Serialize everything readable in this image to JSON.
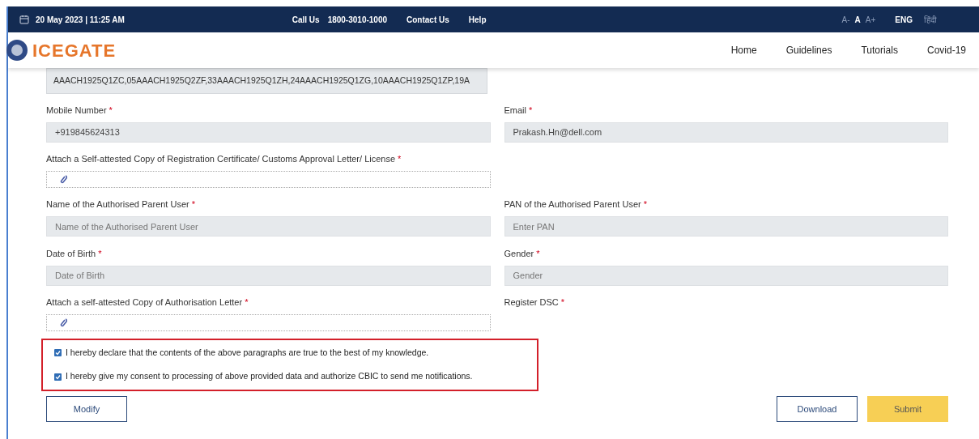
{
  "top_bar": {
    "datetime": "20 May 2023 | 11:25 AM",
    "links": [
      "Call Us",
      "1800-3010-1000",
      "Contact Us",
      "Help"
    ],
    "font_sizes": [
      {
        "label": "A-",
        "selected": false
      },
      {
        "label": "A",
        "selected": true
      },
      {
        "label": "A+",
        "selected": false
      }
    ],
    "languages": [
      {
        "label": "ENG",
        "selected": true
      },
      {
        "label": "हिंदी",
        "selected": false
      }
    ]
  },
  "header": {
    "logo": "ICEGATE",
    "nav": [
      "Home",
      "Guidelines",
      "Tutorials",
      "Covid-19"
    ]
  },
  "gstin_box": {
    "value": "AAACH1925Q1ZC,05AAACH1925Q2ZF,33AAACH1925Q1ZH,24AAACH1925Q1ZG,10AAACH1925Q1ZP,19A"
  },
  "rows": [
    [
      {
        "kind": "input",
        "label": "Mobile Number",
        "required_mark": "*",
        "value": "+919845624313"
      },
      {
        "kind": "input",
        "label": "Email",
        "required_mark": "*",
        "value": "Prakash.Hn@dell.com"
      }
    ],
    [
      {
        "kind": "attach",
        "label": "Attach a Self-attested Copy of Registration Certificate/ Customs Approval Letter/ License",
        "required_mark": "*"
      }
    ],
    [
      {
        "kind": "input",
        "label": "Name of the Authorised Parent User",
        "required_mark": "*",
        "placeholder": "Name of the Authorised Parent User"
      },
      {
        "kind": "input",
        "label": "PAN of the Authorised Parent User",
        "required_mark": "*",
        "placeholder": "Enter PAN"
      }
    ],
    [
      {
        "kind": "input",
        "label": "Date of Birth",
        "required_mark": "*",
        "placeholder": "Date of Birth"
      },
      {
        "kind": "input",
        "label": "Gender",
        "required_mark": "*",
        "placeholder": "Gender"
      }
    ],
    [
      {
        "kind": "attach",
        "label": "Attach a self-attested Copy of Authorisation Letter",
        "required_mark": "*"
      },
      {
        "kind": "label",
        "label": "Register DSC",
        "required_mark": "*"
      }
    ]
  ],
  "declarations": [
    {
      "text": "I hereby declare that the contents of the above paragraphs are true to the best of my knowledge.",
      "checked": true
    },
    {
      "text": "I hereby give my consent to processing of above provided data and authorize CBIC to send me notifications.",
      "checked": true
    }
  ],
  "buttons": [
    {
      "label": "Modify",
      "kind": "outline"
    },
    {
      "label": "Download",
      "kind": "outline"
    },
    {
      "label": "Submit",
      "kind": "primary"
    }
  ]
}
